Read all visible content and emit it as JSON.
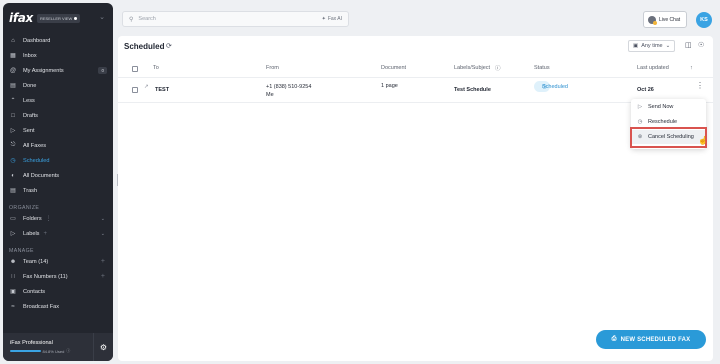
{
  "app": {
    "logo": "ifax",
    "badge": "RESELLER VIEW"
  },
  "search": {
    "placeholder": "Search",
    "fax_ai": "Fax AI"
  },
  "header": {
    "live_chat": "Live Chat",
    "avatar": "KS"
  },
  "sidebar": {
    "items": [
      {
        "label": "Dashboard",
        "icon": "home-icon"
      },
      {
        "label": "Inbox",
        "icon": "inbox-icon"
      },
      {
        "label": "My Assignments",
        "icon": "at-icon",
        "count": "0"
      },
      {
        "label": "Done",
        "icon": "done-icon"
      },
      {
        "label": "Less",
        "icon": "chevron-up-icon"
      },
      {
        "label": "Drafts",
        "icon": "draft-icon"
      },
      {
        "label": "Sent",
        "icon": "send-icon"
      },
      {
        "label": "All Faxes",
        "icon": "all-faxes-icon"
      },
      {
        "label": "Scheduled",
        "icon": "scheduled-icon",
        "active": true
      },
      {
        "label": "All Documents",
        "icon": "documents-icon"
      },
      {
        "label": "Trash",
        "icon": "trash-icon"
      }
    ],
    "organize_label": "ORGANIZE",
    "organize": [
      {
        "label": "Folders",
        "icon": "folder-icon"
      },
      {
        "label": "Labels",
        "icon": "label-icon"
      }
    ],
    "manage_label": "MANAGE",
    "manage": [
      {
        "label": "Team (14)",
        "icon": "team-icon"
      },
      {
        "label": "Fax Numbers (11)",
        "icon": "dialpad-icon"
      },
      {
        "label": "Contacts",
        "icon": "contacts-icon"
      },
      {
        "label": "Broadcast Fax",
        "icon": "broadcast-icon"
      }
    ],
    "plan": {
      "name": "iFax Professional",
      "used": "84.8% Used",
      "used_fraction": 0.848
    }
  },
  "main": {
    "title": "Scheduled",
    "filter": "Any time",
    "columns": [
      "To",
      "From",
      "Document",
      "Labels/Subject",
      "Status",
      "Last updated"
    ],
    "rows": [
      {
        "to": "TEST",
        "from_number": "+1 (838) 510-9254",
        "from_name": "Me",
        "document": "1 page",
        "subject": "Test Schedule",
        "status": "Scheduled",
        "updated": "Oct 26"
      }
    ]
  },
  "menu": {
    "items": [
      "Send Now",
      "Reschedule",
      "Cancel Scheduling"
    ]
  },
  "fab": {
    "label": "NEW SCHEDULED FAX"
  },
  "colors": {
    "sidebar_bg": "#23262e",
    "accent": "#2a9ad8",
    "status_bg": "#dff1fb",
    "highlight": "#d9534f"
  }
}
